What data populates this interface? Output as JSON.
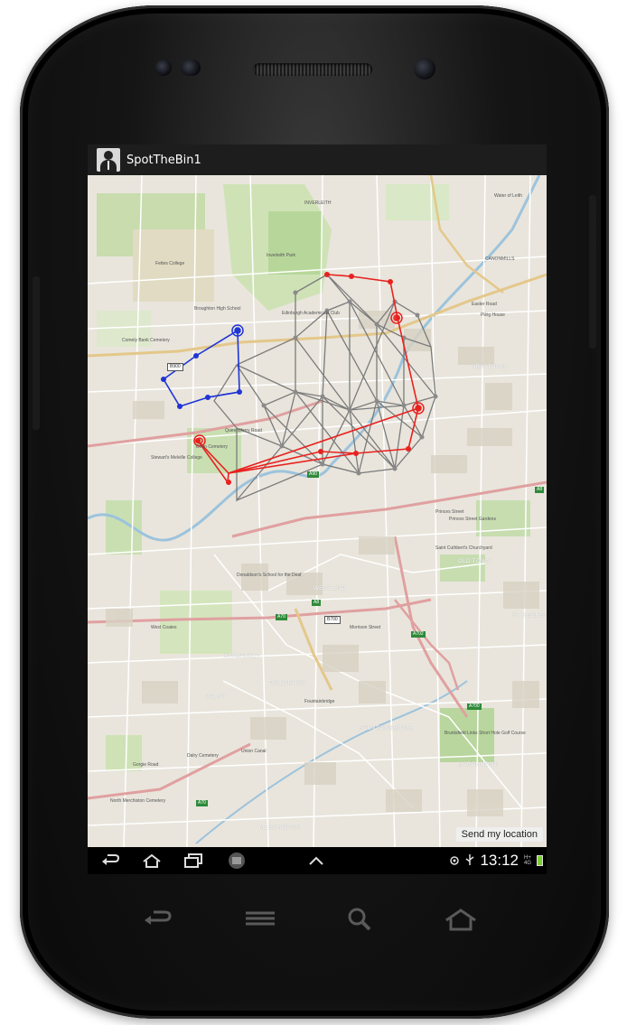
{
  "app": {
    "title": "SpotTheBin1"
  },
  "map": {
    "send_button_label": "Send my location",
    "labels": [
      {
        "text": "INVERLEITH",
        "cls": "map-label"
      },
      {
        "text": "Fettes College",
        "cls": "map-label"
      },
      {
        "text": "Broughton High School",
        "cls": "map-label"
      },
      {
        "text": "Comely Bank Cemetery",
        "cls": "map-label"
      },
      {
        "text": "Inverleith Park",
        "cls": "map-label"
      },
      {
        "text": "Edinburgh Academicals Club",
        "cls": "map-label"
      },
      {
        "text": "Stewart's Melville College",
        "cls": "map-label"
      },
      {
        "text": "Dean Cemetery",
        "cls": "map-label"
      },
      {
        "text": "Queensferry Road",
        "cls": "map-label"
      },
      {
        "text": "Princes Street",
        "cls": "map-label"
      },
      {
        "text": "Princes Street Gardens",
        "cls": "map-label"
      },
      {
        "text": "Saint Cuthbert's Churchyard",
        "cls": "map-label"
      },
      {
        "text": "Donaldson's School for the Deaf",
        "cls": "map-label"
      },
      {
        "text": "West Coates",
        "cls": "map-label"
      },
      {
        "text": "Morrison Street",
        "cls": "map-label"
      },
      {
        "text": "Fountainbridge",
        "cls": "map-label"
      },
      {
        "text": "Bruntsfield Links Short Hole Golf Course",
        "cls": "map-label"
      },
      {
        "text": "Dalry Cemetery",
        "cls": "map-label"
      },
      {
        "text": "Gorgie Road",
        "cls": "map-label"
      },
      {
        "text": "North Merchiston Cemetery",
        "cls": "map-label"
      },
      {
        "text": "Union Canal",
        "cls": "map-label"
      },
      {
        "text": "Easter Road",
        "cls": "map-label"
      },
      {
        "text": "Pilrig House",
        "cls": "map-label"
      },
      {
        "text": "Water of Leith",
        "cls": "map-label"
      },
      {
        "text": "CANONMILLS",
        "cls": "map-label"
      },
      {
        "text": "NEW TOWN",
        "cls": "district"
      },
      {
        "text": "WEST END",
        "cls": "district"
      },
      {
        "text": "OLD TOWN",
        "cls": "district"
      },
      {
        "text": "HAYMARKET",
        "cls": "district"
      },
      {
        "text": "TOLLCROSS",
        "cls": "district"
      },
      {
        "text": "MERCHISTON",
        "cls": "district"
      },
      {
        "text": "MARCHMONT",
        "cls": "district"
      },
      {
        "text": "DALRY",
        "cls": "district"
      },
      {
        "text": "FOUNTAINBRIDGE",
        "cls": "district"
      },
      {
        "text": "ST GEORGE",
        "cls": "district"
      }
    ],
    "shields": [
      "B900",
      "A90",
      "A8",
      "A70",
      "B700",
      "A702",
      "A700",
      "A70",
      "A8"
    ]
  },
  "status_bar": {
    "time": "13:12",
    "signal_text_top": "H+",
    "signal_text_bottom": "4G"
  },
  "colors": {
    "route_red": "#e8211f",
    "route_blue": "#1f35d6",
    "graph_gray": "#7b7b7b",
    "battery": "#7ccf2f"
  }
}
